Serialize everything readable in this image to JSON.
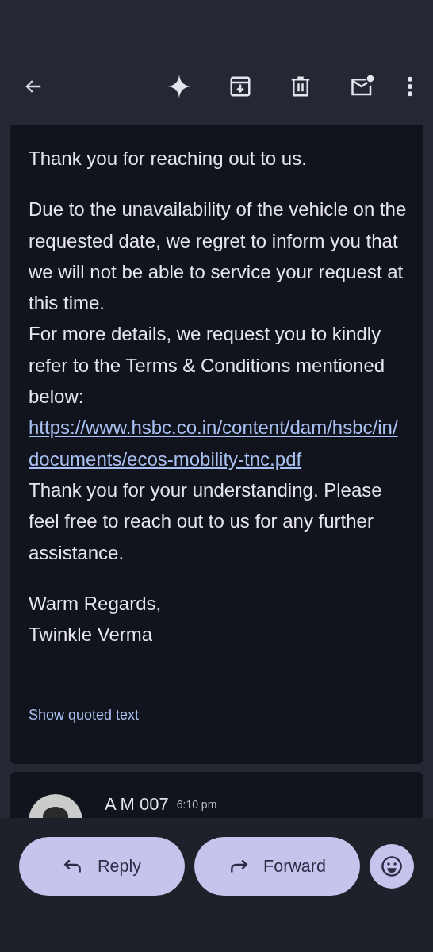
{
  "toolbar": {
    "actions": [
      {
        "kind": "back"
      },
      {
        "kind": "sparkle"
      },
      {
        "kind": "archive"
      },
      {
        "kind": "delete"
      },
      {
        "kind": "unread"
      },
      {
        "kind": "more"
      }
    ]
  },
  "message": {
    "blocks": [
      {
        "lines": [
          {
            "kind": "text",
            "text": "Thank you for reaching out to us."
          }
        ]
      },
      {
        "lines": [
          {
            "kind": "text",
            "text": "Due to the unavailability of the vehicle on the requested date, we regret to inform you that we will not be able to service your request at this time."
          },
          {
            "kind": "text",
            "text": "For more details, we request you to kindly refer to the Terms & Conditions mentioned below:"
          },
          {
            "kind": "link",
            "text": "https://www.hsbc.co.in/content/dam/hsbc/in/documents/ecos-mobility-tnc.pdf"
          },
          {
            "kind": "text",
            "text": "Thank you for your understanding. Please feel free to reach out to us for any further assistance."
          }
        ]
      },
      {
        "lines": [
          {
            "kind": "text",
            "text": "Warm Regards,"
          },
          {
            "kind": "text",
            "text": "Twinkle Verma"
          }
        ]
      }
    ],
    "show_quoted": "Show quoted text"
  },
  "next_message": {
    "sender": "A M 007",
    "time": "6:10 pm"
  },
  "bottom_bar": {
    "buttons": [
      {
        "kind": "reply",
        "label": "Reply"
      },
      {
        "kind": "forward",
        "label": "Forward"
      },
      {
        "kind": "emoji"
      }
    ]
  }
}
